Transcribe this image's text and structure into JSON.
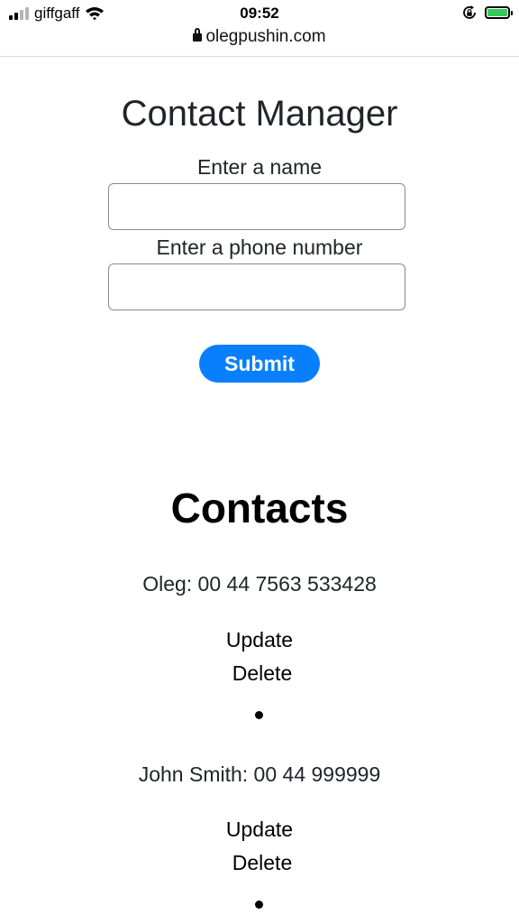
{
  "status_bar": {
    "carrier": "giffgaff",
    "time": "09:52",
    "url": "olegpushin.com",
    "battery_level": 1.0,
    "icons": [
      "signal-icon",
      "wifi-icon",
      "lock-icon",
      "orientation-lock-icon",
      "battery-icon"
    ]
  },
  "form": {
    "title": "Contact Manager",
    "name_label": "Enter a name",
    "name_value": "",
    "phone_label": "Enter a phone number",
    "phone_value": "",
    "submit_label": "Submit"
  },
  "contacts": {
    "title": "Contacts",
    "items": [
      {
        "text": "Oleg: 00 44 7563 533428",
        "update_label": "Update",
        "delete_label": "Delete"
      },
      {
        "text": "John Smith: 00 44 999999",
        "update_label": "Update",
        "delete_label": "Delete"
      }
    ]
  },
  "colors": {
    "primary": "#0a7ffe",
    "battery_fill": "#34c759",
    "text": "#212529"
  }
}
